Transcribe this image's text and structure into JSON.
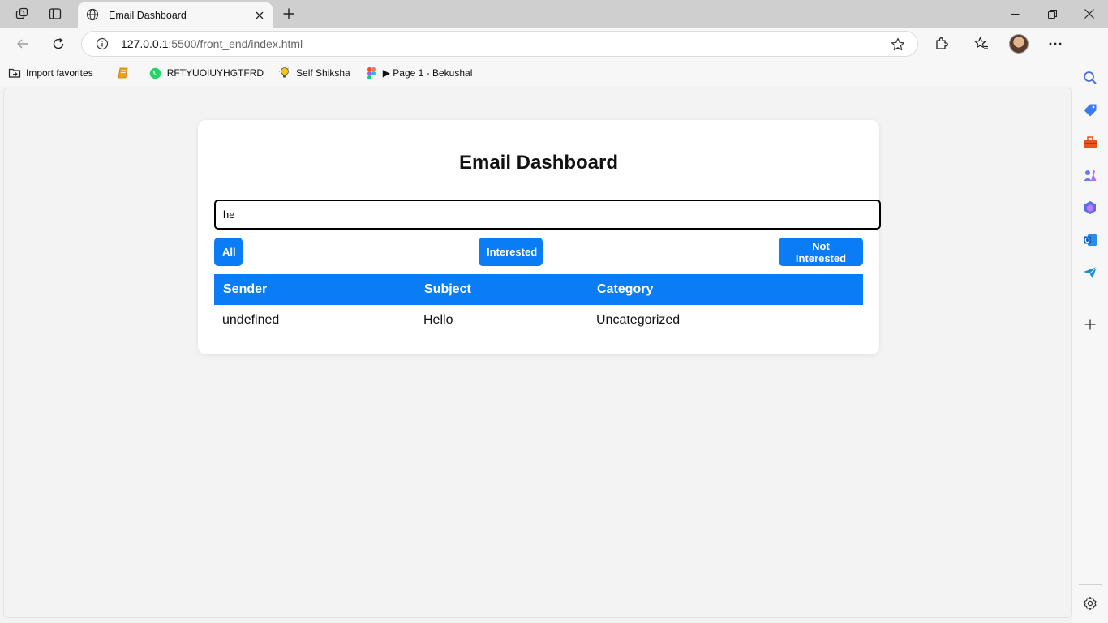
{
  "browser": {
    "tab": {
      "title": "Email Dashboard"
    },
    "url": {
      "host": "127.0.0.1",
      "rest": ":5500/front_end/index.html"
    },
    "favorites": [
      {
        "label": "Import favorites",
        "icon": "import-folder-icon"
      },
      {
        "label": "",
        "icon": "book-icon"
      },
      {
        "label": "RFTYUOIUYHGTFRD",
        "icon": "whatsapp-icon"
      },
      {
        "label": "Self Shiksha",
        "icon": "lightbulb-icon"
      },
      {
        "label": "▶ Page 1 - Bekushal",
        "icon": "figma-icon"
      }
    ]
  },
  "page": {
    "title": "Email Dashboard",
    "search": {
      "value": "he"
    },
    "filters": {
      "all": "All",
      "interested": "Interested",
      "not_interested": "Not Interested"
    },
    "table": {
      "headers": [
        "Sender",
        "Subject",
        "Category"
      ],
      "rows": [
        {
          "sender": "undefined",
          "subject": "Hello",
          "category": "Uncategorized"
        }
      ]
    }
  },
  "colors": {
    "accent": "#0a7cf5",
    "page_bg": "#f3f3f3",
    "card_bg": "#ffffff"
  }
}
